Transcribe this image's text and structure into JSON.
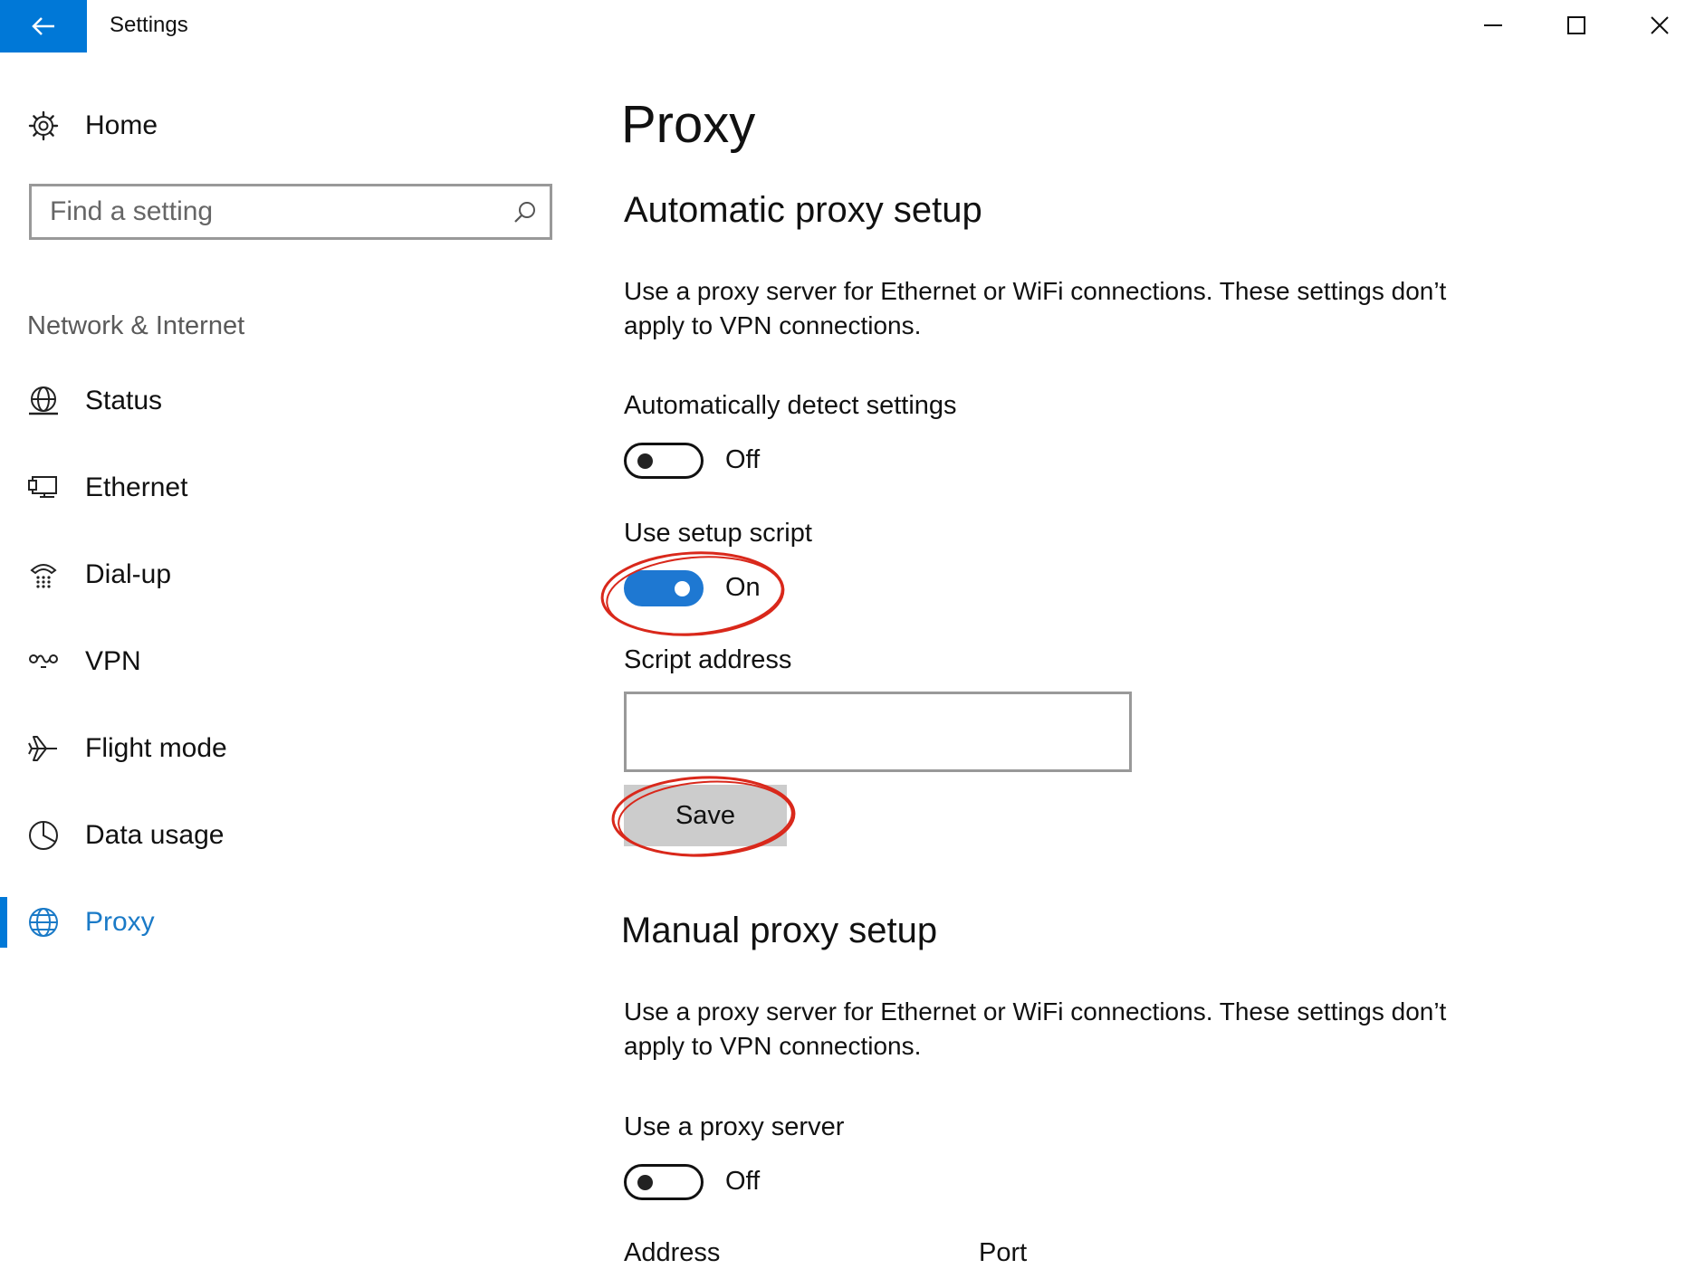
{
  "window": {
    "title": "Settings",
    "back_icon": "back-arrow-icon",
    "controls": [
      "minimize-icon",
      "maximize-icon",
      "close-icon"
    ]
  },
  "sidebar": {
    "home": {
      "label": "Home",
      "icon": "gear-icon"
    },
    "search": {
      "placeholder": "Find a setting",
      "value": "",
      "icon": "search-icon"
    },
    "section": "Network & Internet",
    "items": [
      {
        "label": "Status",
        "icon": "globe-status-icon",
        "selected": false
      },
      {
        "label": "Ethernet",
        "icon": "ethernet-icon",
        "selected": false
      },
      {
        "label": "Dial-up",
        "icon": "dialup-phone-icon",
        "selected": false
      },
      {
        "label": "VPN",
        "icon": "vpn-icon",
        "selected": false
      },
      {
        "label": "Flight mode",
        "icon": "airplane-icon",
        "selected": false
      },
      {
        "label": "Data usage",
        "icon": "pie-chart-icon",
        "selected": false
      },
      {
        "label": "Proxy",
        "icon": "globe-icon",
        "selected": true
      }
    ]
  },
  "main": {
    "title": "Proxy",
    "auto": {
      "heading": "Automatic proxy setup",
      "description": "Use a proxy server for Ethernet or WiFi connections. These settings don’t apply to VPN connections.",
      "detect": {
        "label": "Automatically detect settings",
        "state": "Off",
        "on": false
      },
      "script": {
        "label": "Use setup script",
        "state": "On",
        "on": true
      },
      "address": {
        "label": "Script address",
        "value": ""
      },
      "save_label": "Save"
    },
    "manual": {
      "heading": "Manual proxy setup",
      "description": "Use a proxy server for Ethernet or WiFi connections. These settings don’t apply to VPN connections.",
      "proxy": {
        "label": "Use a proxy server",
        "state": "Off",
        "on": false
      },
      "address_label": "Address",
      "port_label": "Port"
    }
  },
  "colors": {
    "accent": "#0078d7",
    "annotation": "#d9281b"
  }
}
